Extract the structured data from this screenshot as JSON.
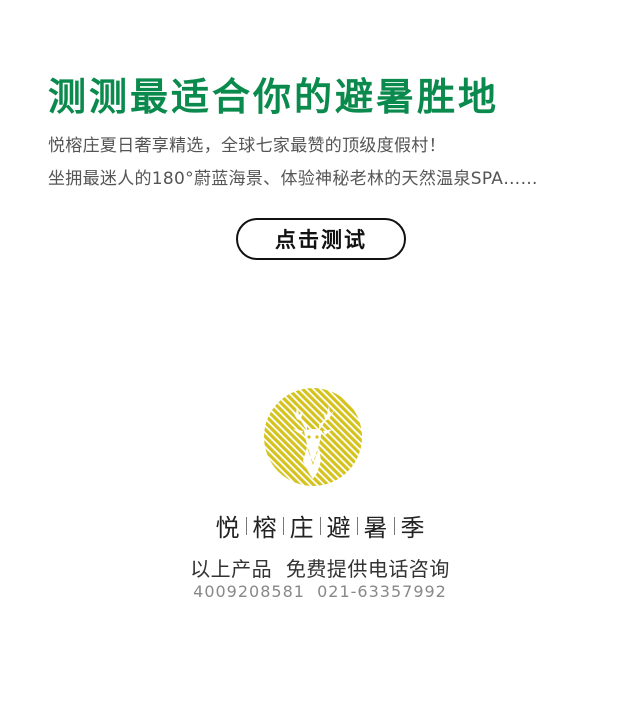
{
  "headline": "测测最适合你的避暑胜地",
  "description": {
    "line1": "悦榕庄夏日奢享精选，全球七家最赞的顶级度假村！",
    "line2": "坐拥最迷人的180°蔚蓝海景、体验神秘老林的天然温泉SPA……"
  },
  "cta": {
    "label": "点击测试"
  },
  "logo": {
    "icon": "deer-head-icon",
    "color": "#d4c21d"
  },
  "brand": {
    "chars": [
      "悦",
      "榕",
      "庄",
      "避",
      "暑",
      "季"
    ]
  },
  "footer": {
    "consult_text": "以上产品  免费提供电话咨询",
    "phone_1": "4009208581",
    "phone_2": "021-63357992"
  },
  "colors": {
    "headline_green": "#0b8a4d",
    "logo_yellow": "#d4c21d"
  }
}
